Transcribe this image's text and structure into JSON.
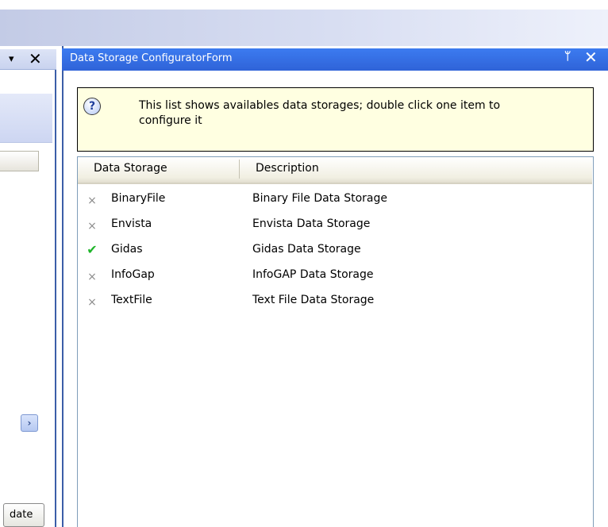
{
  "left_panel": {
    "pin_glyph": "▾",
    "close_glyph": "✕",
    "scroll_arrow_glyph": "›",
    "bottom_button_label": "date"
  },
  "form": {
    "title": "Data Storage ConfiguratorForm",
    "pin_glyph": "ᛘ",
    "close_glyph": "✕",
    "info_icon_glyph": "?",
    "info_text": "This list shows availables data storages; double click one item to configure it",
    "columns": [
      "Data Storage",
      "Description"
    ],
    "rows": [
      {
        "status": "disabled",
        "status_glyph": "×",
        "name": "BinaryFile",
        "description": "Binary File Data Storage"
      },
      {
        "status": "enabled",
        "status_glyph": "✔",
        "name": "Envista",
        "description": "Envista Data Storage"
      },
      {
        "status": "enabled",
        "status_glyph": "✔",
        "name": "Gidas",
        "description": "Gidas Data Storage"
      },
      {
        "status": "disabled",
        "status_glyph": "×",
        "name": "InfoGap",
        "description": "InfoGAP Data Storage"
      },
      {
        "status": "disabled",
        "status_glyph": "×",
        "name": "TextFile",
        "description": "Text File Data Storage"
      }
    ]
  },
  "colors": {
    "title_bar": "#2f63d8",
    "info_background": "#ffffe1",
    "check_green": "#1fb52a",
    "cross_gray": "#8c8c8c"
  }
}
